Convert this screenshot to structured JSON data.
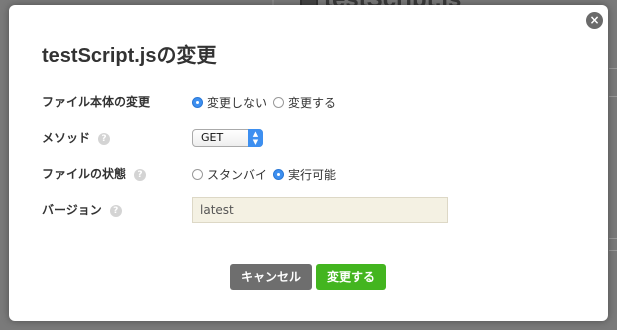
{
  "background": {
    "title": "testScript.js"
  },
  "dialog": {
    "title": "testScript.jsの変更",
    "close_glyph": "×",
    "fields": {
      "file_change": {
        "label": "ファイル本体の変更",
        "options": [
          "変更しない",
          "変更する"
        ],
        "selected": "変更しない"
      },
      "method": {
        "label": "メソッド",
        "help": "?",
        "value": "GET"
      },
      "file_state": {
        "label": "ファイルの状態",
        "help": "?",
        "options": [
          "スタンバイ",
          "実行可能"
        ],
        "selected": "実行可能"
      },
      "version": {
        "label": "バージョン",
        "help": "?",
        "value": "latest"
      }
    },
    "buttons": {
      "cancel": "キャンセル",
      "submit": "変更する"
    }
  },
  "colors": {
    "accent": "#3d8ff0",
    "submit": "#43b51f",
    "cancel": "#6e6e6e",
    "input_bg": "#f4f1e3"
  },
  "icons": [
    "close-icon",
    "help-icon",
    "radio-icon",
    "select-arrows-icon"
  ]
}
